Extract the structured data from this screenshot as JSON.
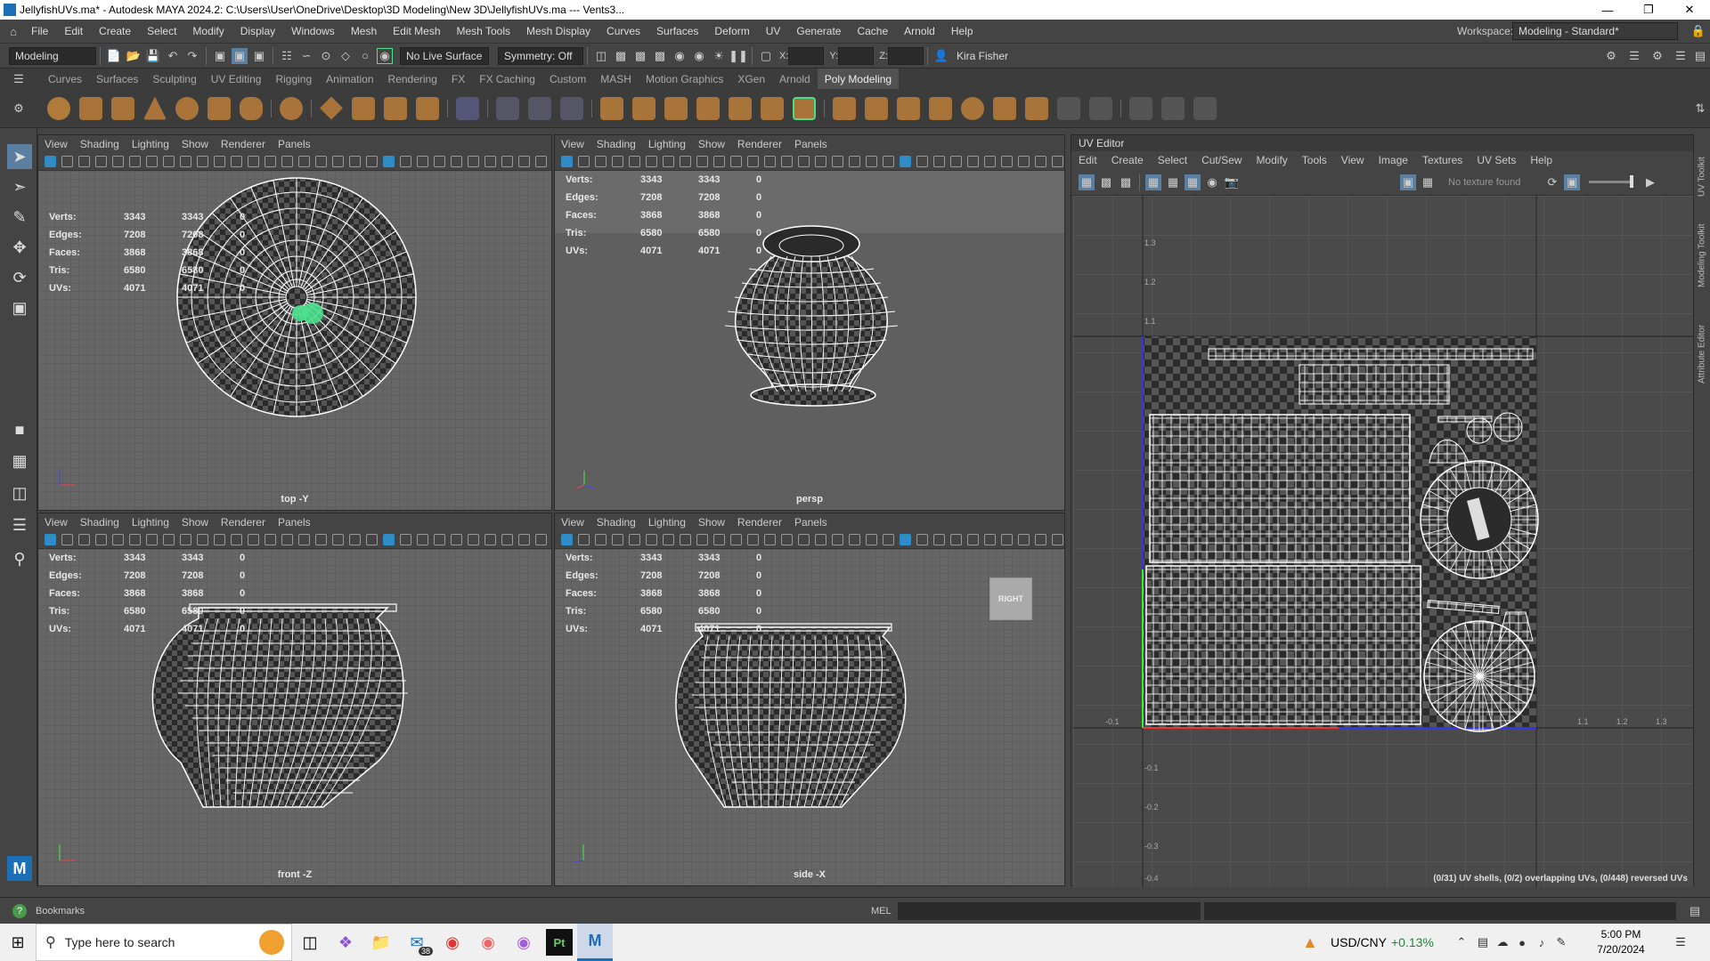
{
  "titlebar": {
    "title": "JellyfishUVs.ma* - Autodesk MAYA 2024.2: C:\\Users\\User\\OneDrive\\Desktop\\3D Modeling\\New 3D\\JellyfishUVs.ma   ---   Vents3..."
  },
  "menubar": {
    "items": [
      "File",
      "Edit",
      "Create",
      "Select",
      "Modify",
      "Display",
      "Windows",
      "Mesh",
      "Edit Mesh",
      "Mesh Tools",
      "Mesh Display",
      "Curves",
      "Surfaces",
      "Deform",
      "UV",
      "Generate",
      "Cache",
      "Arnold",
      "Help"
    ],
    "workspace_label": "Workspace:",
    "workspace_value": "Modeling - Standard*"
  },
  "statusline": {
    "mode": "Modeling",
    "live_surface": "No Live Surface",
    "symmetry": "Symmetry: Off",
    "x_label": "X:",
    "y_label": "Y:",
    "z_label": "Z:",
    "user": "Kira Fisher"
  },
  "shelf": {
    "tabs": [
      "Curves",
      "Surfaces",
      "Sculpting",
      "UV Editing",
      "Rigging",
      "Animation",
      "Rendering",
      "FX",
      "FX Caching",
      "Custom",
      "MASH",
      "Motion Graphics",
      "XGen",
      "Arnold",
      "Poly Modeling"
    ],
    "active": "Poly Modeling"
  },
  "viewport_menu": [
    "View",
    "Shading",
    "Lighting",
    "Show",
    "Renderer",
    "Panels"
  ],
  "hud": {
    "top": {
      "rows": [
        [
          "Verts:",
          "3343",
          "3343",
          "0"
        ],
        [
          "Edges:",
          "7208",
          "7208",
          "0"
        ],
        [
          "Faces:",
          "3868",
          "3868",
          "0"
        ],
        [
          "Tris:",
          "6580",
          "6580",
          "0"
        ],
        [
          "UVs:",
          "4071",
          "4071",
          "0"
        ]
      ],
      "camera": "top -Y"
    },
    "persp": {
      "rows": [
        [
          "Verts:",
          "3343",
          "3343",
          "0"
        ],
        [
          "Edges:",
          "7208",
          "7208",
          "0"
        ],
        [
          "Faces:",
          "3868",
          "3868",
          "0"
        ],
        [
          "Tris:",
          "6580",
          "6580",
          "0"
        ],
        [
          "UVs:",
          "4071",
          "4071",
          "0"
        ]
      ],
      "camera": "persp"
    },
    "front": {
      "rows": [
        [
          "Verts:",
          "3343",
          "3343",
          "0"
        ],
        [
          "Edges:",
          "7208",
          "7208",
          "0"
        ],
        [
          "Faces:",
          "3868",
          "3868",
          "0"
        ],
        [
          "Tris:",
          "6580",
          "6580",
          "0"
        ],
        [
          "UVs:",
          "4071",
          "4071",
          "0"
        ]
      ],
      "camera": "front -Z"
    },
    "side": {
      "rows": [
        [
          "Verts:",
          "3343",
          "3343",
          "0"
        ],
        [
          "Edges:",
          "7208",
          "7208",
          "0"
        ],
        [
          "Faces:",
          "3868",
          "3868",
          "0"
        ],
        [
          "Tris:",
          "6580",
          "6580",
          "0"
        ],
        [
          "UVs:",
          "4071",
          "4071",
          "0"
        ]
      ],
      "camera": "side -X",
      "viewcube": "RIGHT"
    }
  },
  "uv_editor": {
    "title": "UV Editor",
    "menu": [
      "Edit",
      "Create",
      "Select",
      "Cut/Sew",
      "Modify",
      "Tools",
      "View",
      "Image",
      "Textures",
      "UV Sets",
      "Help"
    ],
    "texture": "No texture found",
    "ticks_left": [
      "1.3",
      "1.2",
      "1.1",
      "-0.1",
      "-0.2",
      "-0.3",
      "-0.4"
    ],
    "ticks_bottom": [
      "-0.1",
      "1.1",
      "1.2",
      "1.3"
    ],
    "status": "(0/31) UV shells, (0/2) overlapping UVs, (0/448) reversed UVs"
  },
  "side_tabs": [
    "UV Toolkit",
    "Modeling Toolkit",
    "Attribute Editor"
  ],
  "helpline": {
    "bookmarks": "Bookmarks",
    "mel": "MEL"
  },
  "taskbar": {
    "search": "Type here to search",
    "mail_badge": "38",
    "ticker": "USD/CNY",
    "ticker_change": "+0.13%",
    "time": "5:00 PM",
    "date": "7/20/2024"
  },
  "colors": {
    "accent": "#2f8cc7",
    "selection": "#49e08c",
    "wire": "#ffffff"
  }
}
